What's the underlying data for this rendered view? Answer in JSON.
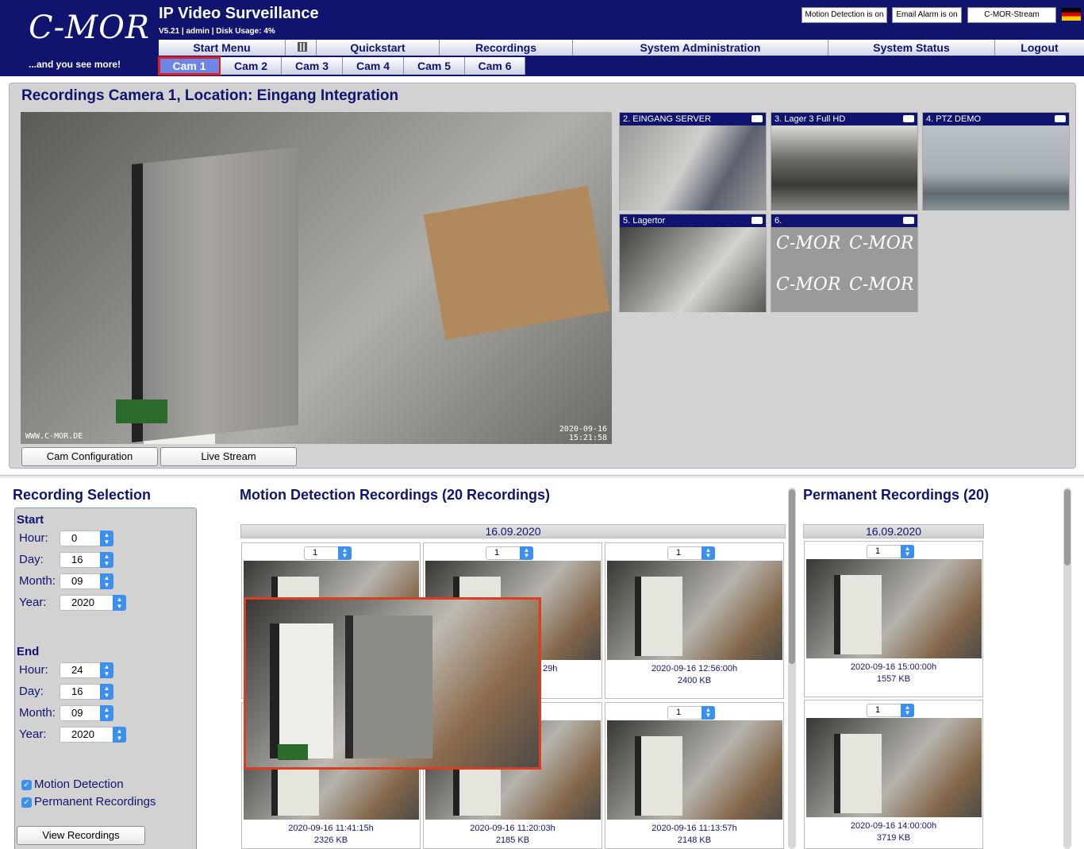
{
  "header": {
    "logo_big": "C-MOR",
    "logo_small": "...and you see more!",
    "title": "IP Video Surveillance",
    "subtitle": "V5.21 | admin | Disk Usage: 4%",
    "motion_btn": "Motion Detection is on",
    "email_btn": "Email Alarm is on",
    "stream_btn": "C-MOR-Stream"
  },
  "nav": {
    "start": "Start Menu",
    "quickstart": "Quickstart",
    "recordings": "Recordings",
    "sysadmin": "System Administration",
    "status": "System Status",
    "logout": "Logout"
  },
  "cams": [
    "Cam 1",
    "Cam 2",
    "Cam 3",
    "Cam 4",
    "Cam 5",
    "Cam 6"
  ],
  "panel": {
    "title": "Recordings Camera 1, Location: Eingang Integration",
    "watermark": "WWW.C-MOR.DE",
    "ts_date": "2020-09-16",
    "ts_time": "15:21:58",
    "cfg_btn": "Cam Configuration",
    "live_btn": "Live Stream"
  },
  "thumbs": [
    "2. EINGANG SERVER",
    "3. Lager 3 Full HD",
    "4. PTZ DEMO",
    "5. Lagertor",
    "6."
  ],
  "logo_tile": {
    "big": "C-MOR",
    "small": "...and you see more!"
  },
  "selection": {
    "title": "Recording Selection",
    "start": "Start",
    "end": "End",
    "hour": "Hour:",
    "day": "Day:",
    "month": "Month:",
    "year": "Year:",
    "start_hour": "0",
    "start_day": "16",
    "start_month": "09",
    "start_year": "2020",
    "end_hour": "24",
    "end_day": "16",
    "end_month": "09",
    "end_year": "2020",
    "motion": "Motion Detection",
    "permanent": "Permanent Recordings",
    "view": "View Recordings"
  },
  "motion": {
    "title": "Motion Detection Recordings (20 Recordings)",
    "date": "16.09.2020",
    "sel": "1",
    "items": [
      {
        "time": "",
        "size": ""
      },
      {
        "time": "29h",
        "size": ""
      },
      {
        "time": "2020-09-16 12:56:00h",
        "size": "2400 KB"
      },
      {
        "time": "2020-09-16 11:41:15h",
        "size": "2326 KB"
      },
      {
        "time": "2020-09-16 11:20:03h",
        "size": "2185 KB"
      },
      {
        "time": "2020-09-16 11:13:57h",
        "size": "2148 KB"
      }
    ]
  },
  "permanent": {
    "title": "Permanent Recordings (20)",
    "date": "16.09.2020",
    "sel": "1",
    "items": [
      {
        "time": "2020-09-16 15:00:00h",
        "size": "1557 KB"
      },
      {
        "time": "2020-09-16 14:00:00h",
        "size": "3719 KB"
      }
    ]
  }
}
